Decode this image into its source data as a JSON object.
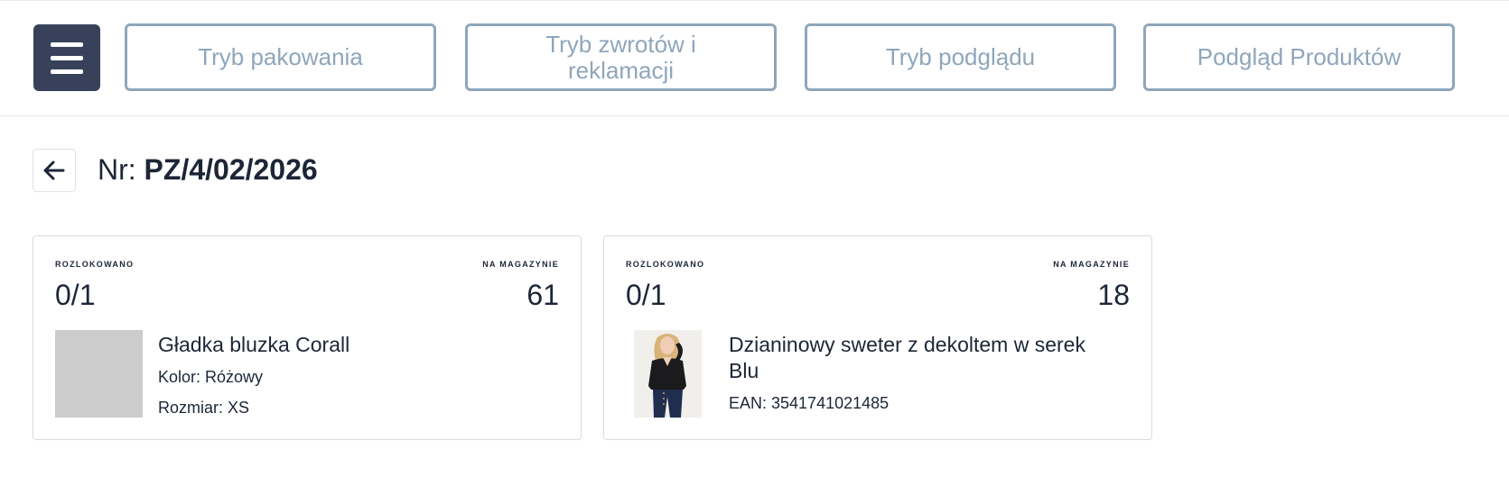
{
  "toolbar": {
    "menu_icon": "hamburger-icon",
    "modes": [
      {
        "label": "Tryb pakowania"
      },
      {
        "label": "Tryb zwrotów i reklamacji"
      },
      {
        "label": "Tryb podglądu"
      },
      {
        "label": "Podgląd Produktów"
      }
    ]
  },
  "header": {
    "back_icon": "arrow-left-icon",
    "nr_label": "Nr:",
    "document_number": "PZ/4/02/2026"
  },
  "cards": [
    {
      "allocated_label": "ROZLOKOWANO",
      "allocated_value": "0/1",
      "stock_label": "NA MAGAZYNIE",
      "stock_value": "61",
      "product_name": "Gładka bluzka Corall",
      "color_line": "Kolor: Różowy",
      "size_line": "Rozmiar: XS"
    },
    {
      "allocated_label": "ROZLOKOWANO",
      "allocated_value": "0/1",
      "stock_label": "NA MAGAZYNIE",
      "stock_value": "18",
      "product_name": "Dzianinowy sweter z dekoltem w serek Blu",
      "ean_line": "EAN: 3541741021485"
    }
  ],
  "colors": {
    "menu_bg": "#37425a",
    "mode_border": "#8fa6bb",
    "text_dark": "#1d2637",
    "placeholder": "#cccccc"
  }
}
